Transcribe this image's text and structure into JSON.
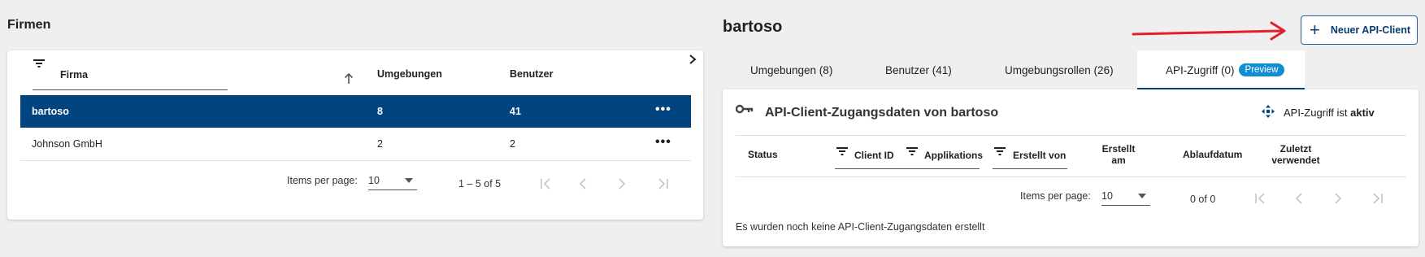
{
  "left": {
    "title": "Firmen",
    "table": {
      "headers": {
        "firma": "Firma",
        "umgebungen": "Umgebungen",
        "benutzer": "Benutzer"
      },
      "rows": [
        {
          "firma": "bartoso",
          "umgebungen": "8",
          "benutzer": "41",
          "selected": true
        },
        {
          "firma": "Johnson GmbH",
          "umgebungen": "2",
          "benutzer": "2",
          "selected": false
        }
      ]
    },
    "pager": {
      "items_label": "Items per page:",
      "page_size": "10",
      "range": "1 – 5 of 5"
    }
  },
  "right": {
    "title": "bartoso",
    "new_button": "Neuer API-Client",
    "tabs": [
      {
        "label": "Umgebungen (8)"
      },
      {
        "label": "Benutzer (41)"
      },
      {
        "label": "Umgebungsrollen (26)"
      },
      {
        "label": "API-Zugriff (0)",
        "badge": "Preview",
        "active": true
      }
    ],
    "section_title": "API-Client-Zugangsdaten von bartoso",
    "status": {
      "prefix": "API-Zugriff ist",
      "value": "aktiv"
    },
    "columns": {
      "status": "Status",
      "client_id": "Client ID",
      "applikations": "Applikations",
      "erstellt_von": "Erstellt von",
      "erstellt_am_1": "Erstellt",
      "erstellt_am_2": "am",
      "ablaufdatum": "Ablaufdatum",
      "zuletzt_1": "Zuletzt",
      "zuletzt_2": "verwendet"
    },
    "pager": {
      "items_label": "Items per page:",
      "page_size": "10",
      "range": "0 of 0"
    },
    "empty_message": "Es wurden noch keine API-Client-Zugangsdaten erstellt"
  },
  "colors": {
    "primary": "#02447f",
    "badge": "#118ed2",
    "annotation_arrow": "#e0202b"
  }
}
